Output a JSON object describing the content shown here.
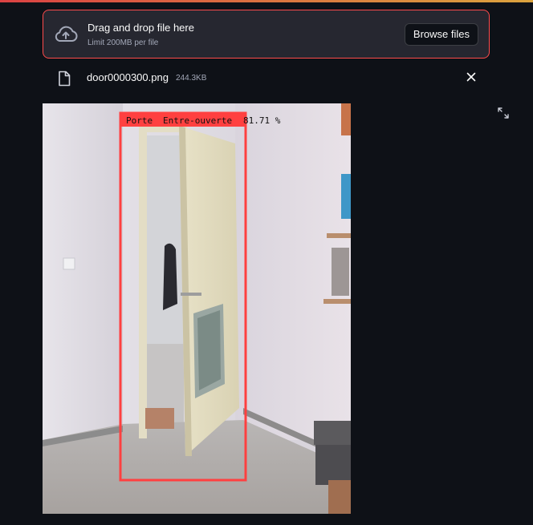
{
  "uploader": {
    "title": "Drag and drop file here",
    "limit": "Limit 200MB per file",
    "browse_label": "Browse files",
    "icon": "cloud-upload-icon"
  },
  "file": {
    "name": "door0000300.png",
    "size": "244.3KB",
    "icon": "file-icon",
    "remove_icon": "close-icon"
  },
  "image": {
    "detection": {
      "class_label": "Porte",
      "state_label": "Entre-ouverte",
      "confidence": "81.71 %"
    },
    "fullscreen_icon": "expand-icon"
  },
  "colors": {
    "background": "#0e1117",
    "dropzone_bg": "#262730",
    "accent": "#ff4b4b",
    "detection_box": "#ff4040"
  }
}
